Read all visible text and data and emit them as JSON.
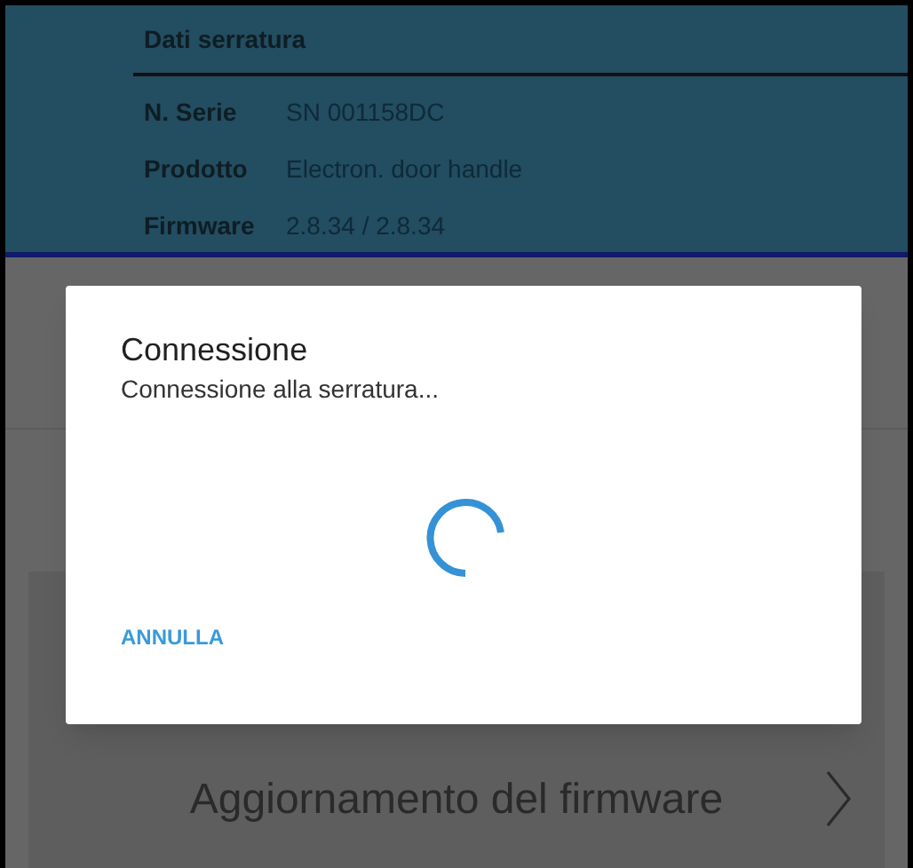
{
  "lock_data": {
    "title": "Dati serratura",
    "rows": [
      {
        "label": "N. Serie",
        "value": "SN 001158DC"
      },
      {
        "label": "Prodotto",
        "value": "Electron. door handle"
      },
      {
        "label": "Firmware",
        "value": "2.8.34 / 2.8.34"
      }
    ]
  },
  "menu_item": {
    "label": "Aggiornamento del firmware"
  },
  "dialog": {
    "title": "Connessione",
    "message": "Connessione alla serratura...",
    "buttons": [
      "ANNULLA"
    ]
  }
}
